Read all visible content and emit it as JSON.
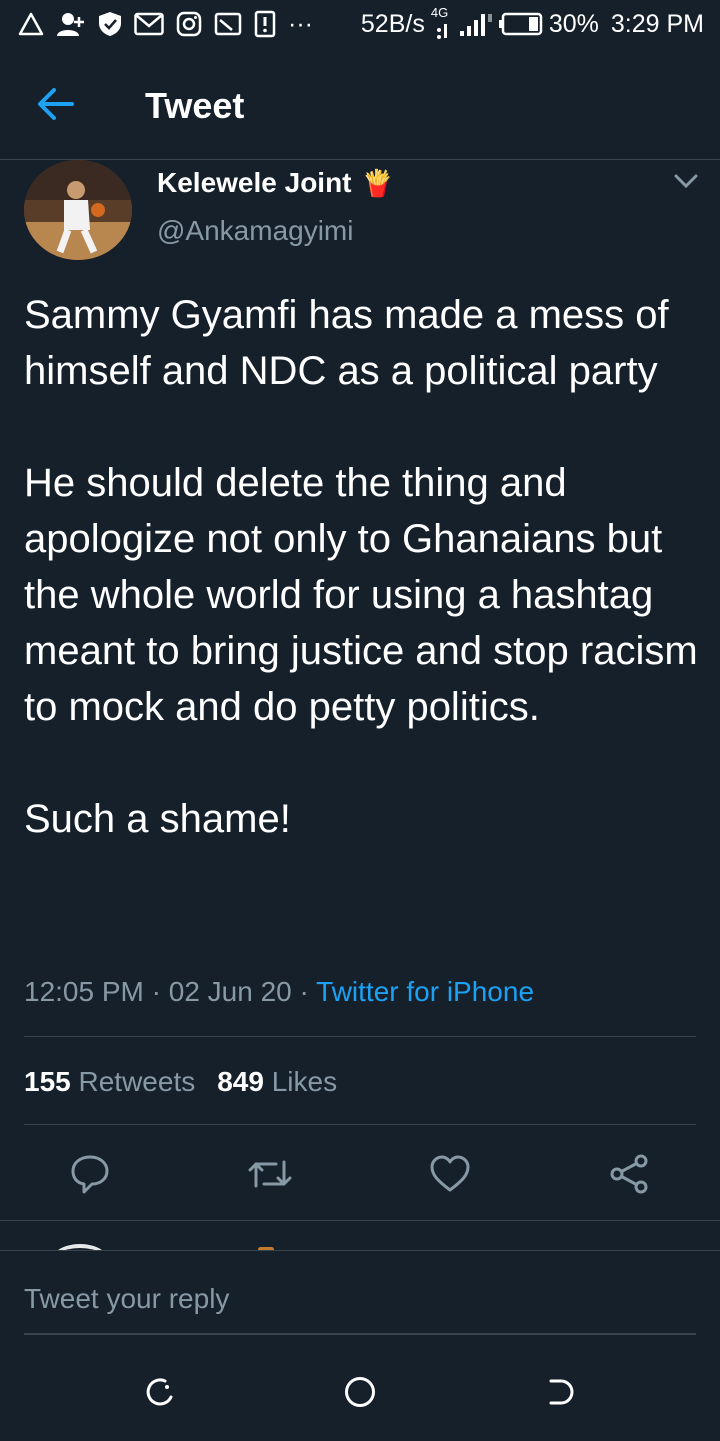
{
  "status_bar": {
    "speed": "52B/s",
    "network_type": "4G",
    "battery_percent": "30%",
    "time": "3:29 PM",
    "more": "···",
    "left_icons": [
      "warning-icon",
      "person-add-icon",
      "shield-icon",
      "gmail-icon",
      "instagram-icon",
      "cast-icon",
      "alert-icon"
    ]
  },
  "header": {
    "back_icon": "arrow-left-icon",
    "title": "Tweet"
  },
  "tweet": {
    "display_name": "Kelewele Joint",
    "name_emoji": "🍟",
    "handle": "@Ankamagyimi",
    "text": "Sammy Gyamfi has made a mess of himself and NDC as a political party\n\nHe should delete the thing and apologize not only to Ghanaians but the whole world for using a hashtag meant to bring justice and stop racism to mock and do petty politics.\n\nSuch a shame!",
    "time": "12:05 PM",
    "date": "02 Jun 20",
    "separator": "·",
    "source": "Twitter for iPhone",
    "retweets_count": "155",
    "retweets_label": "Retweets",
    "likes_count": "849",
    "likes_label": "Likes"
  },
  "actions": [
    "reply-icon",
    "retweet-icon",
    "like-icon",
    "share-icon"
  ],
  "reply": {
    "placeholder": "Tweet your reply"
  },
  "colors": {
    "background": "#15202b",
    "divider": "#38444d",
    "muted": "#8899a6",
    "accent": "#1da1f2"
  }
}
